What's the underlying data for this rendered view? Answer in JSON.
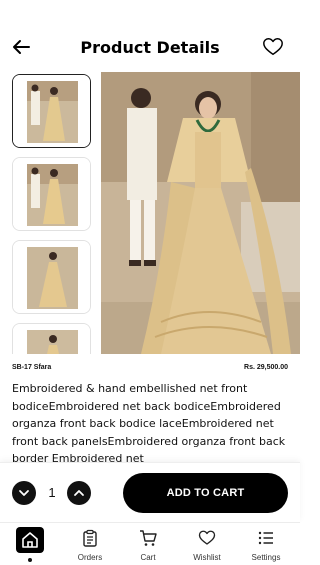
{
  "header": {
    "title": "Product Details"
  },
  "product": {
    "sku": "SB-17 Sfara",
    "price": "Rs. 29,500.00",
    "description": "Embroidered & hand embellished net front bodiceEmbroidered net back bodiceEmbroidered organza front back bodice laceEmbroidered net front back panelsEmbroidered organza front back border Embroidered net"
  },
  "cart": {
    "quantity": "1",
    "add_label": "ADD TO CART"
  },
  "nav": {
    "items": [
      {
        "label": ""
      },
      {
        "label": "Orders"
      },
      {
        "label": "Cart"
      },
      {
        "label": "Wishlist"
      },
      {
        "label": "Settings"
      }
    ]
  },
  "colors": {
    "accent": "#000000",
    "dress": "#e2c793",
    "background": "#ffffff"
  }
}
